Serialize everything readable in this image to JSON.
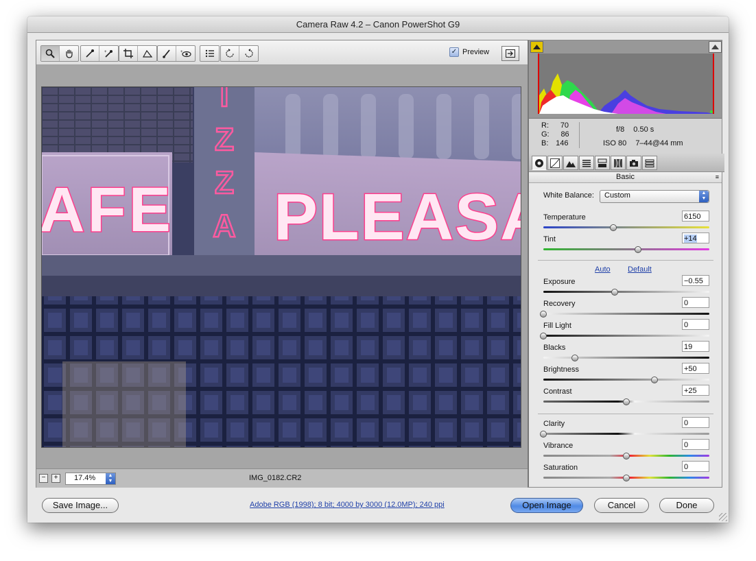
{
  "window": {
    "title": "Camera Raw 4.2  –  Canon PowerShot G9"
  },
  "toolbar": {
    "tools": [
      {
        "name": "zoom-tool",
        "icon": "magnifier-icon"
      },
      {
        "name": "hand-tool",
        "icon": "hand-icon"
      },
      {
        "name": "white-balance-tool",
        "icon": "eyedropper-icon"
      },
      {
        "name": "color-sampler-tool",
        "icon": "eyedropper-plus-icon"
      },
      {
        "name": "crop-tool",
        "icon": "crop-icon"
      },
      {
        "name": "straighten-tool",
        "icon": "straighten-icon"
      },
      {
        "name": "retouch-tool",
        "icon": "brush-icon"
      },
      {
        "name": "red-eye-tool",
        "icon": "red-eye-icon"
      },
      {
        "name": "preferences-button",
        "icon": "list-icon"
      },
      {
        "name": "rotate-left-button",
        "icon": "rotate-ccw-icon"
      },
      {
        "name": "rotate-right-button",
        "icon": "rotate-cw-icon"
      }
    ],
    "preview_label": "Preview",
    "preview_checked": true
  },
  "image": {
    "filename": "IMG_0182.CR2",
    "sign_text_left": "AFE",
    "sign_text_right": "PLEASA",
    "sign_vertical": [
      "I",
      "Z",
      "Z",
      "A"
    ]
  },
  "zoom": {
    "value": "17.4%",
    "minus": "−",
    "plus": "+"
  },
  "info": {
    "r_label": "R:",
    "r": "70",
    "g_label": "G:",
    "g": "86",
    "b_label": "B:",
    "b": "146",
    "aperture": "f/8",
    "shutter": "0.50 s",
    "iso": "ISO 80",
    "lens": "7–44@44 mm"
  },
  "panel": {
    "title": "Basic",
    "white_balance_label": "White Balance:",
    "white_balance_value": "Custom",
    "auto_link": "Auto",
    "default_link": "Default",
    "sliders": [
      {
        "label": "Temperature",
        "value": "6150",
        "position": 0.42
      },
      {
        "label": "Tint",
        "value": "+14",
        "position": 0.57
      },
      {
        "label": "Exposure",
        "value": "−0.55",
        "position": 0.43
      },
      {
        "label": "Recovery",
        "value": "0",
        "position": 0.0
      },
      {
        "label": "Fill Light",
        "value": "0",
        "position": 0.0
      },
      {
        "label": "Blacks",
        "value": "19",
        "position": 0.19
      },
      {
        "label": "Brightness",
        "value": "+50",
        "position": 0.67
      },
      {
        "label": "Contrast",
        "value": "+25",
        "position": 0.5
      },
      {
        "label": "Clarity",
        "value": "0",
        "position": 0.0
      },
      {
        "label": "Vibrance",
        "value": "0",
        "position": 0.5
      },
      {
        "label": "Saturation",
        "value": "0",
        "position": 0.5
      }
    ]
  },
  "footer": {
    "save_label": "Save Image...",
    "workflow_link": "Adobe RGB (1998); 8 bit; 4000 by 3000 (12.0MP); 240 ppi",
    "open_label": "Open Image",
    "cancel_label": "Cancel",
    "done_label": "Done"
  },
  "colors": {
    "accent": "#4f8ae5",
    "link": "#1e3fa8",
    "neon": "#ff3d8c"
  }
}
